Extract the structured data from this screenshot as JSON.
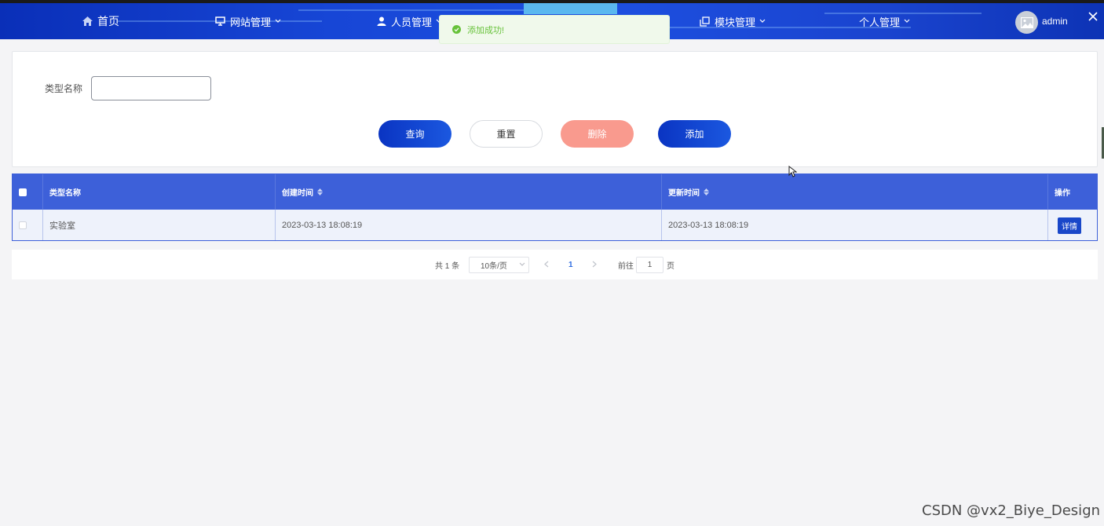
{
  "nav": {
    "home": "首页",
    "website": "网站管理",
    "staff": "人员管理",
    "module": "模块管理",
    "personal": "个人管理",
    "user": "admin"
  },
  "toast": {
    "message": "添加成功!",
    "color": "#67c23a"
  },
  "search": {
    "label": "类型名称",
    "value": "",
    "placeholder": ""
  },
  "buttons": {
    "query": "查询",
    "reset": "重置",
    "delete": "删除",
    "add": "添加"
  },
  "table": {
    "headers": [
      "类型名称",
      "创建时间",
      "更新时间",
      "操作"
    ],
    "rows": [
      {
        "name": "实验室",
        "created": "2023-03-13 18:08:19",
        "updated": "2023-03-13 18:08:19",
        "action": "详情"
      }
    ]
  },
  "pagination": {
    "total": "共 1 条",
    "page_size": "10条/页",
    "current_page": "1",
    "goto_label": "前往",
    "goto_value": "1",
    "page_unit": "页"
  },
  "watermark": "CSDN @vx2_Biye_Design",
  "colors": {
    "nav_bg": "#1746d6",
    "primary": "#0a34c2",
    "table_header": "#3d60d9",
    "delete": "#f99a8e",
    "success": "#67c23a"
  }
}
